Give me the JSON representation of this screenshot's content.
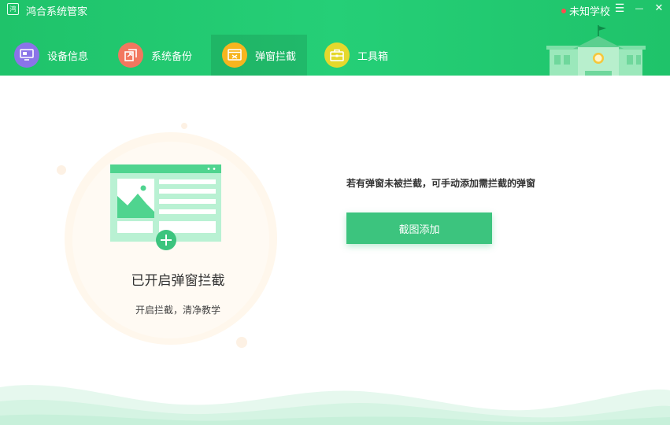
{
  "app": {
    "logo_text": "鸿",
    "title": "鸿合系统管家",
    "school_name": "未知学校"
  },
  "window_controls": {
    "menu": "☰",
    "minimize": "—",
    "close": "✕"
  },
  "tabs": [
    {
      "label": "设备信息",
      "icon": "device-info-icon",
      "color": "#8b74e8",
      "active": false
    },
    {
      "label": "系统备份",
      "icon": "system-backup-icon",
      "color": "#f2775f",
      "active": false
    },
    {
      "label": "弹窗拦截",
      "icon": "popup-block-icon",
      "color": "#f7b51f",
      "active": true
    },
    {
      "label": "工具箱",
      "icon": "toolbox-icon",
      "color": "#e5d82c",
      "active": false
    }
  ],
  "main": {
    "status_title": "已开启弹窗拦截",
    "status_sub": "开启拦截，清净教学",
    "hint": "若有弹窗未被拦截，可手动添加需拦截的弹窗",
    "capture_button": "截图添加"
  },
  "colors": {
    "header_green": "#25cf77",
    "button_green": "#3cc47e",
    "illustration_green": "#4fd48f"
  }
}
